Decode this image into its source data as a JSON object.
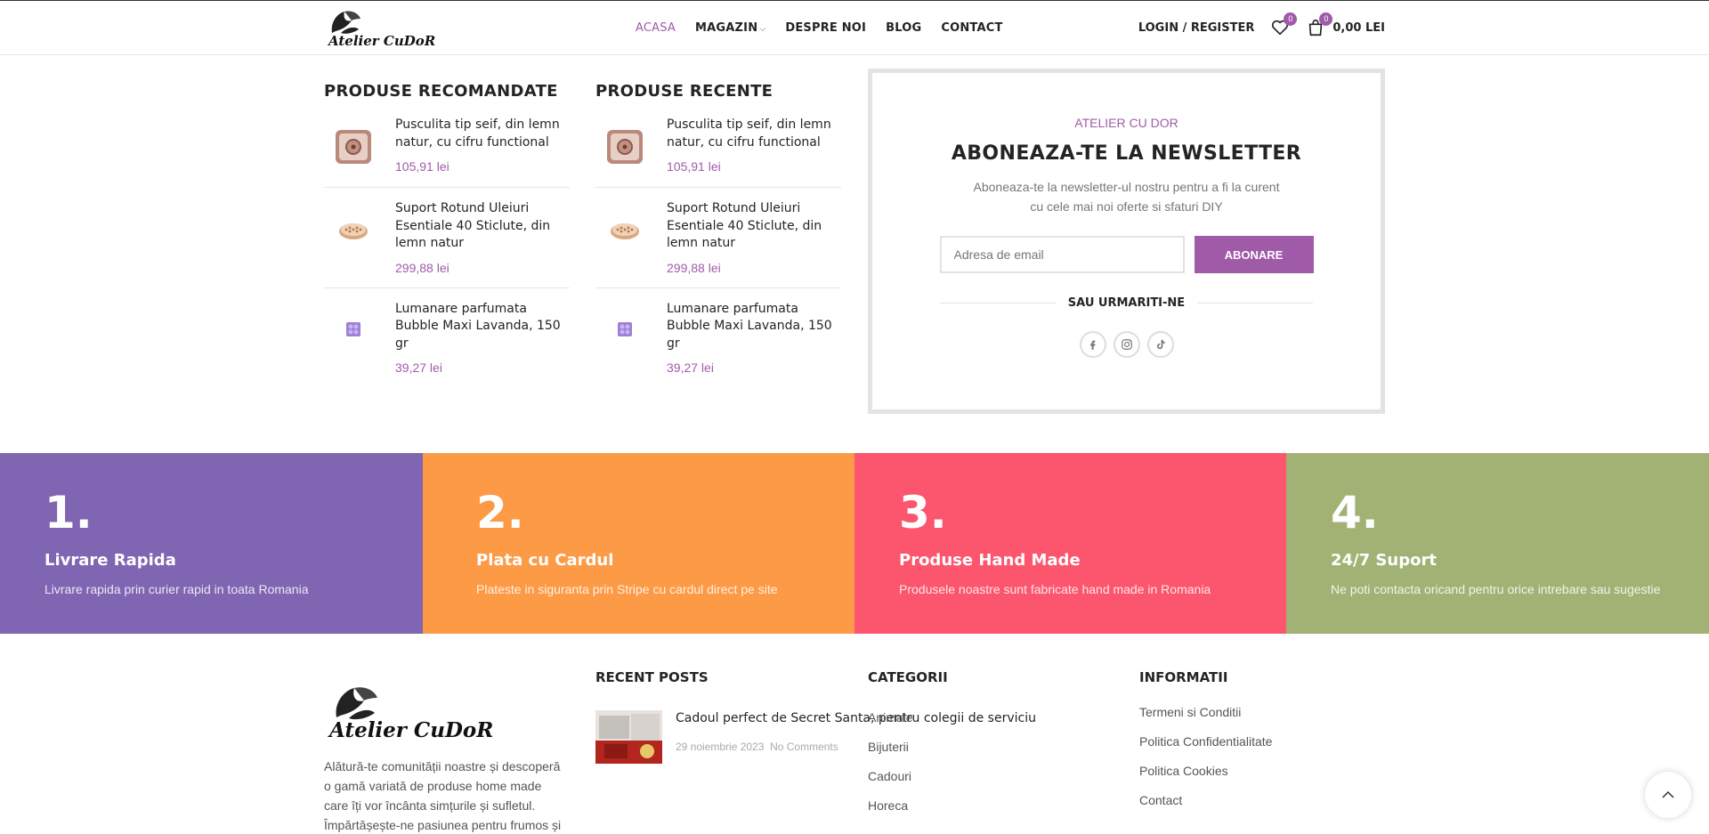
{
  "header": {
    "logo_text": "Atelier CuDoR",
    "nav": [
      {
        "label": "ACASA"
      },
      {
        "label": "MAGAZIN"
      },
      {
        "label": "DESPRE NOI"
      },
      {
        "label": "BLOG"
      },
      {
        "label": "CONTACT"
      }
    ],
    "login_label": "LOGIN / REGISTER",
    "wishlist_count": "0",
    "cart_count": "0",
    "cart_total": "0,00 LEI"
  },
  "recommended": {
    "title": "PRODUSE RECOMANDATE",
    "items": [
      {
        "name": "Pusculita tip seif, din lemn natur, cu cifru functional",
        "price": "105,91 lei"
      },
      {
        "name": "Suport Rotund Uleiuri Esentiale 40 Sticlute, din lemn natur",
        "price": "299,88 lei"
      },
      {
        "name": "Lumanare parfumata Bubble Maxi Lavanda, 150 gr",
        "price": "39,27 lei"
      }
    ]
  },
  "recent": {
    "title": "PRODUSE RECENTE",
    "items": [
      {
        "name": "Pusculita tip seif, din lemn natur, cu cifru functional",
        "price": "105,91 lei"
      },
      {
        "name": "Suport Rotund Uleiuri Esentiale 40 Sticlute, din lemn natur",
        "price": "299,88 lei"
      },
      {
        "name": "Lumanare parfumata Bubble Maxi Lavanda, 150 gr",
        "price": "39,27 lei"
      }
    ]
  },
  "newsletter": {
    "kicker": "ATELIER CU DOR",
    "title": "ABONEAZA-TE LA NEWSLETTER",
    "description": "Aboneaza-te la newsletter-ul nostru pentru a fi la curent cu cele mai noi oferte si sfaturi DIY",
    "email_placeholder": "Adresa de email",
    "button_label": "ABONARE",
    "or_follow": "SAU URMARITI-NE"
  },
  "features": [
    {
      "num": "1.",
      "title": "Livrare Rapida",
      "text": "Livrare rapida prin curier rapid in toata Romania",
      "color": "#8065b3"
    },
    {
      "num": "2.",
      "title": "Plata cu Cardul",
      "text": "Plateste in siguranta prin Stripe cu cardul direct pe site",
      "color": "#fd9a46"
    },
    {
      "num": "3.",
      "title": "Produse Hand Made",
      "text": "Produsele noastre sunt fabricate hand made in Romania",
      "color": "#fc556e"
    },
    {
      "num": "4.",
      "title": "24/7 Suport",
      "text": "Ne poti contacta oricand pentru orice intrebare sau sugestie",
      "color": "#a2b274"
    }
  ],
  "footer": {
    "about": "Alătură-te comunității noastre și descoperă o gamă variată de produse home made care îți vor încânta simțurile și sufletul. Împărtășește-ne pasiunea pentru frumos și",
    "recent_posts_title": "RECENT POSTS",
    "post": {
      "title": "Cadoul perfect de Secret Santa, pentru colegii de serviciu",
      "date": "29 noiembrie 2023",
      "comments": "No Comments"
    },
    "categories_title": "CATEGORII",
    "categories": [
      "Animale",
      "Bijuterii",
      "Cadouri",
      "Horeca"
    ],
    "info_title": "INFORMATII",
    "info_links": [
      "Termeni si Conditii",
      "Politica Confidentialitate",
      "Politica Cookies",
      "Contact"
    ]
  },
  "colors": {
    "accent": "#a05ba8"
  }
}
